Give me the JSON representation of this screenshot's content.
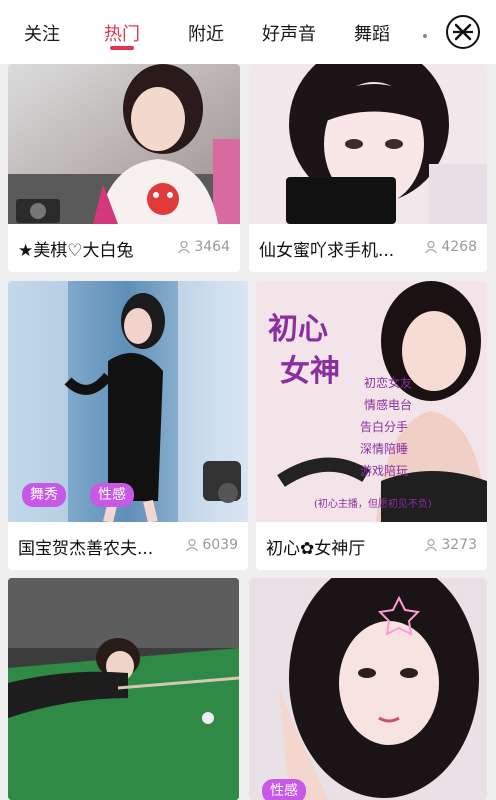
{
  "tabs": [
    {
      "label": "关注"
    },
    {
      "label": "热门",
      "active": true
    },
    {
      "label": "附近"
    },
    {
      "label": "好声音"
    },
    {
      "label": "舞蹈"
    }
  ],
  "close_icon": "close-circle-icon",
  "colors": {
    "accent": "#e5344b",
    "tag": "#c759e6",
    "count": "#999999"
  },
  "cards": [
    {
      "title": "★美棋♡大白兔",
      "viewers": "3464",
      "tags": []
    },
    {
      "title": "仙女蜜吖求手机...",
      "viewers": "4268",
      "tags": []
    },
    {
      "title": "国宝贺杰善农夫...",
      "viewers": "6039",
      "tags": [
        "舞秀",
        "性感"
      ]
    },
    {
      "title": "初心✿女神厅",
      "viewers": "3273",
      "tags": [],
      "poster_text": [
        "初心",
        "女神",
        "初恋女友",
        "情感电台",
        "告白分手",
        "深情陪睡",
        "游戏陪玩",
        "(初心主播，但愿初见不负)"
      ]
    },
    {
      "title": "",
      "viewers": "",
      "tags": []
    },
    {
      "title": "",
      "viewers": "",
      "tags": [
        "性感"
      ]
    }
  ]
}
